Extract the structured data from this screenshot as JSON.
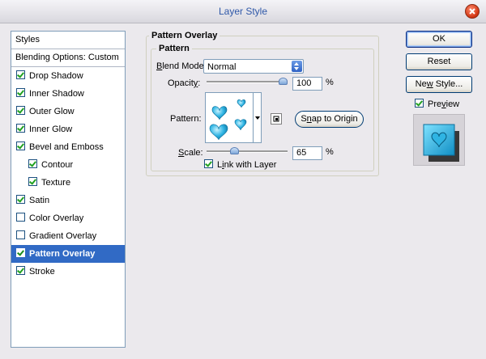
{
  "window": {
    "title": "Layer Style"
  },
  "styles": {
    "header": "Styles",
    "blending": "Blending Options: Custom",
    "items": [
      {
        "label": "Drop Shadow",
        "checked": true
      },
      {
        "label": "Inner Shadow",
        "checked": true
      },
      {
        "label": "Outer Glow",
        "checked": true
      },
      {
        "label": "Inner Glow",
        "checked": true
      },
      {
        "label": "Bevel and Emboss",
        "checked": true
      },
      {
        "label": "Contour",
        "checked": true
      },
      {
        "label": "Texture",
        "checked": true
      },
      {
        "label": "Satin",
        "checked": true
      },
      {
        "label": "Color Overlay",
        "checked": false
      },
      {
        "label": "Gradient Overlay",
        "checked": false
      },
      {
        "label": "Pattern Overlay",
        "checked": true
      },
      {
        "label": "Stroke",
        "checked": true
      }
    ]
  },
  "panel": {
    "section_title": "Pattern Overlay",
    "group_title": "Pattern",
    "blend_mode_label": "lend Mode:",
    "blend_mode_accel": "B",
    "blend_mode_value": "Normal",
    "opacity_label": "Opacit",
    "opacity_accel": "y",
    "opacity_suffix": ":",
    "opacity_value": "100",
    "opacity_unit": "%",
    "opacity_level": 1.0,
    "pattern_label": "Pattern:",
    "snap_accel": "n",
    "snap_rest": "ap to Origin",
    "snap_prefix": "S",
    "scale_accel": "S",
    "scale_label": "cale:",
    "scale_value": "65",
    "scale_unit": "%",
    "scale_level": 0.65,
    "link_accel": "i",
    "link_prefix": "L",
    "link_rest": "nk with Layer",
    "link_checked": true
  },
  "buttons": {
    "ok": "OK",
    "reset": "Reset",
    "new_style_prefix": "Ne",
    "new_style_accel": "w",
    "new_style_rest": " Style...",
    "preview_prefix": "Pre",
    "preview_accel": "v",
    "preview_rest": "iew",
    "preview_checked": true
  },
  "colors": {
    "selection": "#316ac5",
    "heart": "#2fb4e3",
    "title_text": "#2f58a8"
  }
}
